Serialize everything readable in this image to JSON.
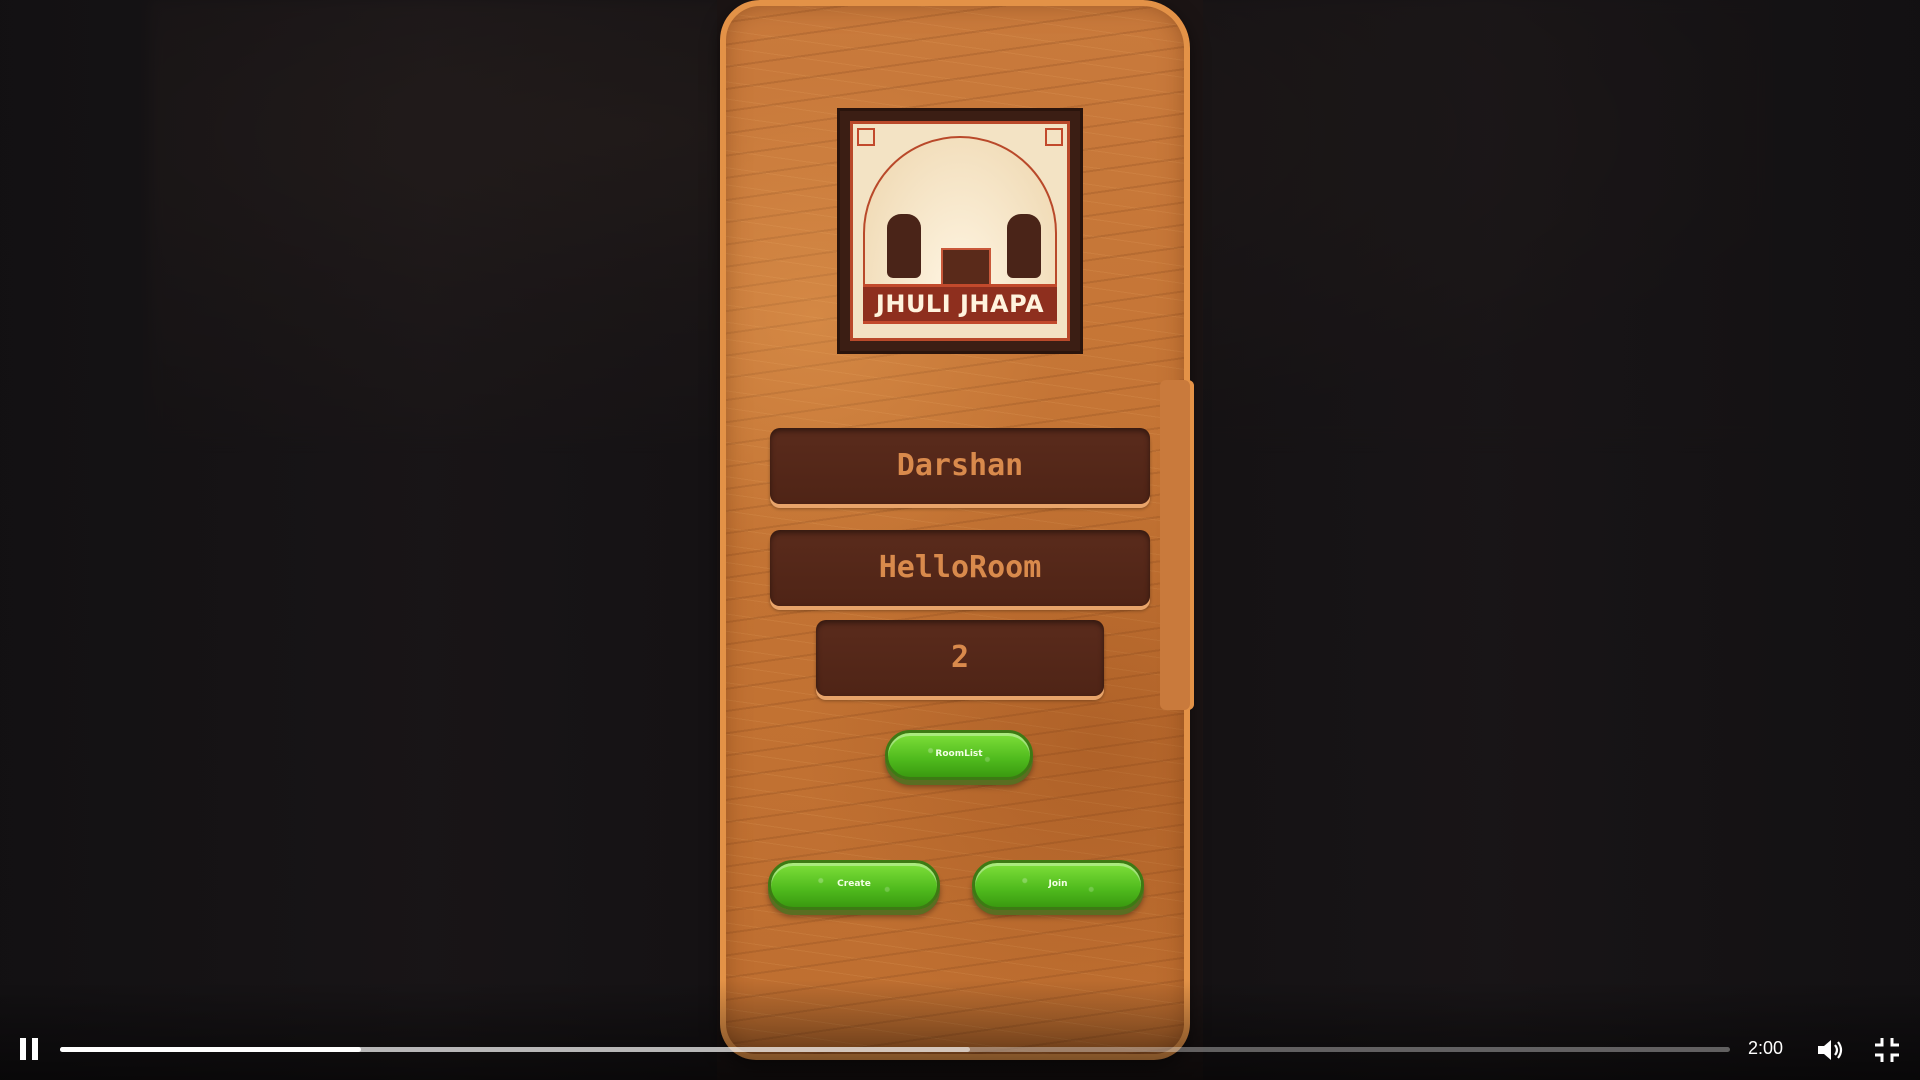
{
  "game": {
    "logo_text": "JHULI JHAPA",
    "player_name": "Darshan",
    "room_name": "HelloRoom",
    "player_count": "2",
    "roomlist_label": "RoomList",
    "create_label": "Create",
    "join_label": "Join"
  },
  "player": {
    "time": "2:00",
    "progress": 0.18,
    "buffered": 0.545
  },
  "colors": {
    "board": "#c97a3c",
    "field_text": "#d98a4c",
    "button_green": "#4fba1d"
  },
  "icons": [
    "pause-icon",
    "volume-icon",
    "exit-fullscreen-icon"
  ]
}
